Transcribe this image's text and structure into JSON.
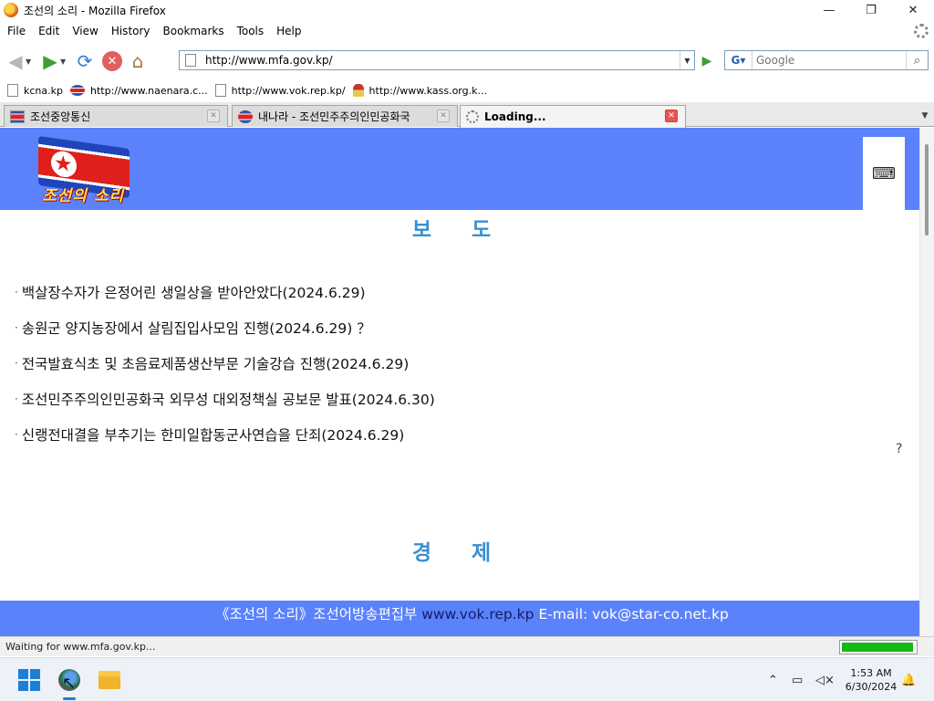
{
  "window": {
    "title": "조선의 소리 - Mozilla Firefox",
    "controls": {
      "minimize": "—",
      "maximize": "❐",
      "close": "✕"
    }
  },
  "menu": [
    "File",
    "Edit",
    "View",
    "History",
    "Bookmarks",
    "Tools",
    "Help"
  ],
  "navigation": {
    "url": "http://www.mfa.gov.kp/",
    "search_placeholder": "Google",
    "search_engine_label": "G"
  },
  "bookmarks": [
    {
      "label": "kcna.kp",
      "icon": "page-icon"
    },
    {
      "label": "http://www.naenara.c...",
      "icon": "flag-icon"
    },
    {
      "label": "http://www.vok.rep.kp/",
      "icon": "page-icon"
    },
    {
      "label": "http://www.kass.org.k...",
      "icon": "torch-icon"
    }
  ],
  "tabs": [
    {
      "label": "조선중앙통신",
      "icon": "kcna-icon",
      "active": false
    },
    {
      "label": "내나라 - 조선민주주의인민공화국",
      "icon": "naenara-icon",
      "active": false
    },
    {
      "label": "Loading...",
      "icon": "loading-icon",
      "active": true
    }
  ],
  "page": {
    "logo_text": "조선의 소리",
    "sections": {
      "news_title": "보 도",
      "economy_title": "경 제"
    },
    "news_items": [
      "백살장수자가 은정어린 생일상을 받아안았다(2024.6.29)",
      "송원군 양지농장에서 살림집입사모임 진행(2024.6.29) ？",
      "전국발효식초 및 초음료제품생산부문 기술강습 진행(2024.6.29)",
      "조선민주주의인민공화국 외무성 대외정책실 공보문 발표(2024.6.30)",
      "신랭전대결을 부추기는 한미일합동군사연습을 단죄(2024.6.29)"
    ],
    "stray_mark": "?",
    "footer": {
      "org": "《조선의 소리》조선어방송편집부",
      "site": "www.vok.rep.kp",
      "email": "E-mail: vok@star-co.net.kp"
    }
  },
  "status": {
    "text": "Waiting for www.mfa.gov.kp...",
    "progress_percent": 97
  },
  "taskbar": {
    "time": "1:53 AM",
    "date": "6/30/2024"
  },
  "colors": {
    "site_blue": "#5b82fa",
    "section_title": "#3a8fd0",
    "progress_green": "#16b716"
  }
}
